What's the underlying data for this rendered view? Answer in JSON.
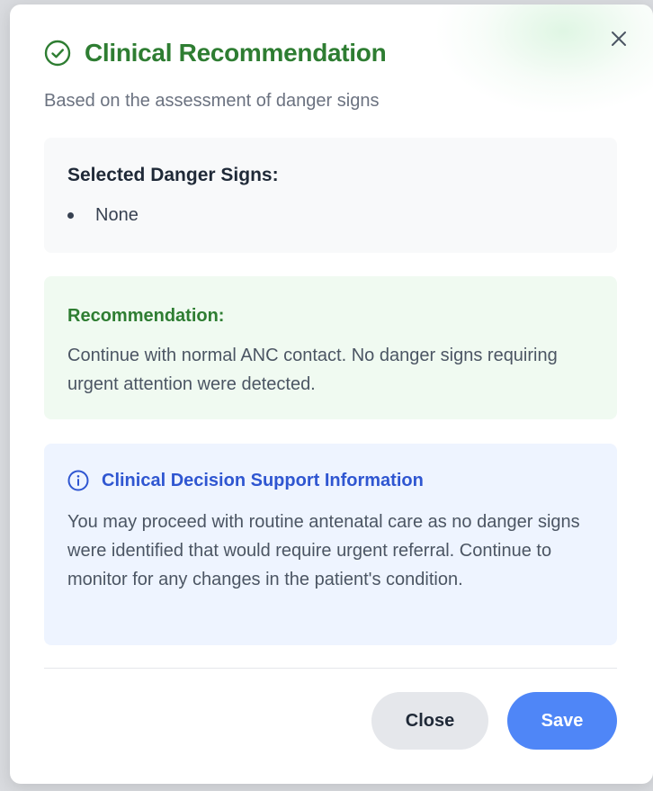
{
  "dialog": {
    "title": "Clinical Recommendation",
    "subtitle": "Based on the assessment of danger signs",
    "close_icon": "close-icon",
    "title_icon": "check-circle-icon"
  },
  "danger_signs": {
    "label": "Selected Danger Signs:",
    "items": [
      "None"
    ]
  },
  "recommendation": {
    "label": "Recommendation:",
    "text": "Continue with normal ANC contact. No danger signs requiring urgent attention were detected."
  },
  "decision_support": {
    "icon": "info-icon",
    "title": "Clinical Decision Support Information",
    "text": "You may proceed with routine antenatal care as no danger signs were identified that would require urgent referral. Continue to monitor for any changes in the patient's condition."
  },
  "actions": {
    "close_label": "Close",
    "save_label": "Save"
  },
  "colors": {
    "success": "#2e7d32",
    "info": "#2f56d1",
    "primary": "#4f86f7"
  }
}
